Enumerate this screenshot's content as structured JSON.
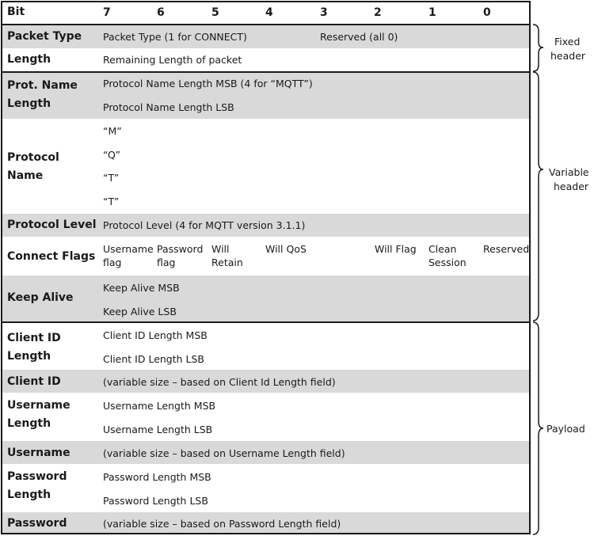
{
  "header": {
    "bit_label": "Bit",
    "bits": [
      "7",
      "6",
      "5",
      "4",
      "3",
      "2",
      "1",
      "0"
    ]
  },
  "rows": {
    "packet_type": {
      "label": "Packet Type",
      "text": "Packet Type (1 for CONNECT)",
      "reserved": "Reserved (all 0)"
    },
    "length": {
      "label": "Length",
      "text": "Remaining Length of packet"
    },
    "prot_name_length": {
      "label_line1": "Prot. Name",
      "label_line2": "Length",
      "msb": "Protocol Name Length MSB (4 for “MQTT”)",
      "lsb": "Protocol Name Length LSB"
    },
    "protocol_name": {
      "label_line1": "Protocol",
      "label_line2": "Name",
      "chars": [
        "“M”",
        "“Q”",
        "“T”",
        "“T”"
      ]
    },
    "protocol_level": {
      "label": "Protocol Level",
      "text": "Protocol Level (4 for MQTT version 3.1.1)"
    },
    "connect_flags": {
      "label": "Connect Flags",
      "username_l1": "Username",
      "username_l2": "flag",
      "password_l1": "Password",
      "password_l2": "flag",
      "will_retain_l1": "Will",
      "will_retain_l2": "Retain",
      "will_qos": "Will QoS",
      "will_flag": "Will Flag",
      "clean_l1": "Clean",
      "clean_l2": "Session",
      "reserved": "Reserved"
    },
    "keep_alive": {
      "label": "Keep Alive",
      "msb": "Keep Alive MSB",
      "lsb": "Keep Alive LSB"
    },
    "client_id_length": {
      "label_line1": "Client ID",
      "label_line2": "Length",
      "msb": "Client ID Length MSB",
      "lsb": "Client ID Length LSB"
    },
    "client_id": {
      "label": "Client ID",
      "text": "(variable size – based on Client Id Length field)"
    },
    "username_length": {
      "label_line1": "Username",
      "label_line2": "Length",
      "msb": "Username Length MSB",
      "lsb": "Username Length LSB"
    },
    "username": {
      "label": "Username",
      "text": "(variable size – based on Username Length field)"
    },
    "password_length": {
      "label_line1": "Password",
      "label_line2": "Length",
      "msb": "Password Length MSB",
      "lsb": "Password Length LSB"
    },
    "password": {
      "label": "Password",
      "text": "(variable size – based on Password Length field)"
    }
  },
  "sections": {
    "fixed_l1": "Fixed",
    "fixed_l2": "header",
    "variable_l1": "Variable",
    "variable_l2": "header",
    "payload": "Payload"
  }
}
